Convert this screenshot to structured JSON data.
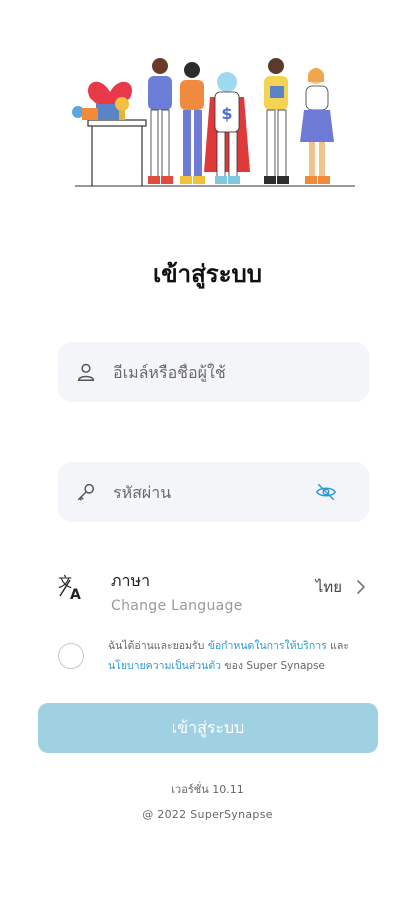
{
  "hero": {
    "illustration": "team-people-illustration"
  },
  "title": "เข้าสู่ระบบ",
  "username": {
    "placeholder": "อีเมล์หรือชื่อผู้ใช้",
    "value": "",
    "icon": "user-icon"
  },
  "password": {
    "placeholder": "รหัสผ่าน",
    "value": "",
    "icon": "key-icon",
    "toggle_icon": "eye-off-icon"
  },
  "language": {
    "icon": "translate-icon",
    "label": "ภาษา",
    "sublabel": "Change Language",
    "current": "ไทย",
    "chevron": "chevron-right-icon"
  },
  "terms": {
    "prefix": "ฉันได้อ่านและยอมรับ ",
    "terms_link": "ข้อกำหนดในการให้บริการ",
    "middle": " และ ",
    "privacy_link": "นโยบายความเป็นส่วนตัว",
    "suffix": " ของ Super Synapse",
    "checked": false
  },
  "login_button": "เข้าสู่ระบบ",
  "version": "เวอร์ชั่น 10.11",
  "copyright": "@ 2022 SuperSynapse",
  "colors": {
    "accent": "#2d9ad3",
    "button": "#9fd1e3",
    "field_bg": "#f4f5f9"
  }
}
